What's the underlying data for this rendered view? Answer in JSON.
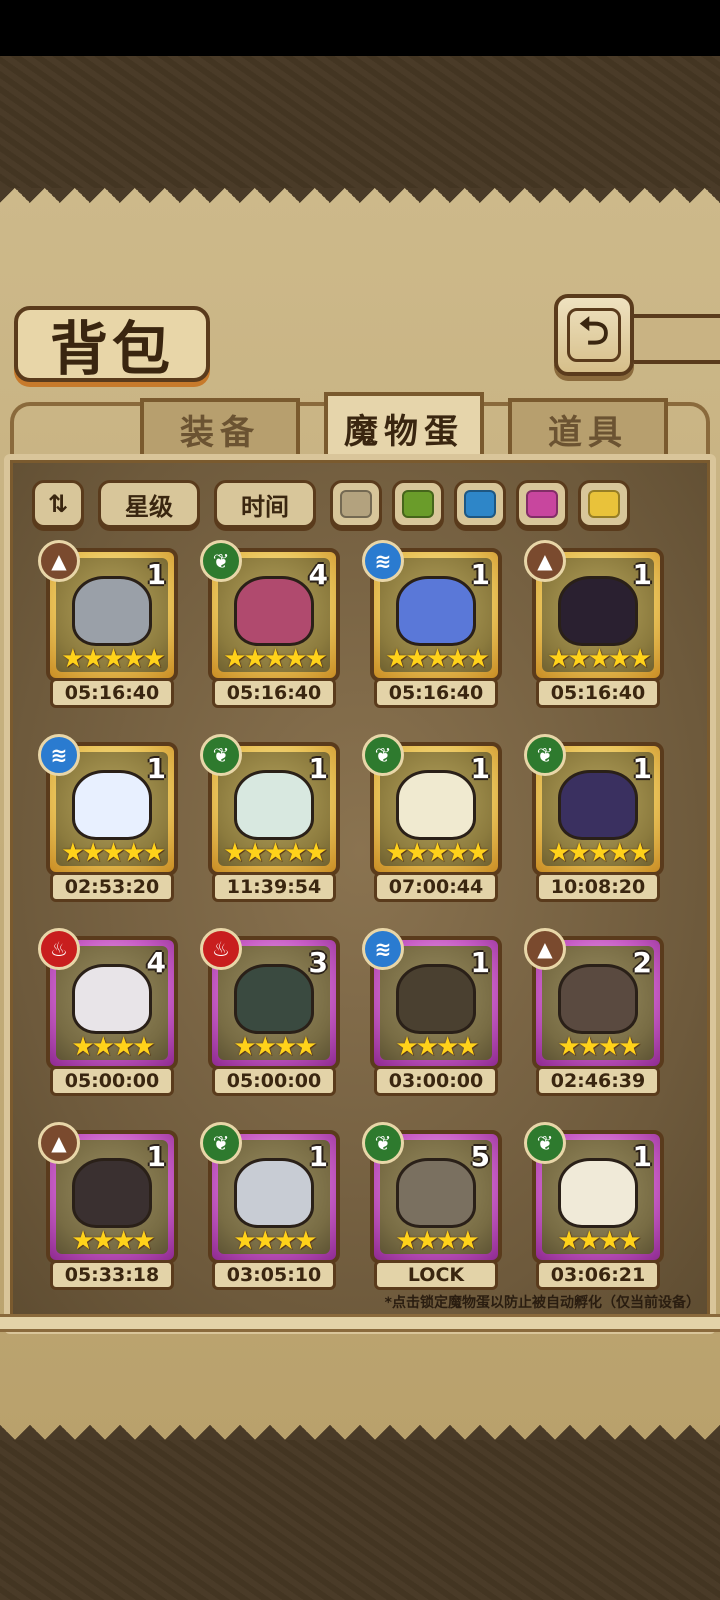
{
  "header": {
    "title": "背包"
  },
  "tabs": [
    {
      "label": "装备",
      "active": false
    },
    {
      "label": "魔物蛋",
      "active": true
    },
    {
      "label": "道具",
      "active": false
    }
  ],
  "filters": {
    "sort_icon": "sort-toggle-icon",
    "star_label": "星级",
    "time_label": "时间",
    "colors": [
      "#b3a27e",
      "#6a9c2a",
      "#2e86c8",
      "#c8469e",
      "#e9c23a"
    ]
  },
  "items": [
    {
      "element": "earth",
      "rarity": "gold",
      "count": "1",
      "stars": 5,
      "timer": "05:16:40",
      "icon": "cube-egg-icon"
    },
    {
      "element": "leaf",
      "rarity": "gold",
      "count": "4",
      "stars": 5,
      "timer": "05:16:40",
      "icon": "katana-egg-icon"
    },
    {
      "element": "water",
      "rarity": "gold",
      "count": "1",
      "stars": 5,
      "timer": "05:16:40",
      "icon": "ice-blade-egg-icon"
    },
    {
      "element": "earth",
      "rarity": "gold",
      "count": "1",
      "stars": 5,
      "timer": "05:16:40",
      "icon": "dark-hood-egg-icon"
    },
    {
      "element": "water",
      "rarity": "gold",
      "count": "1",
      "stars": 5,
      "timer": "02:53:20",
      "icon": "heart-egg-icon"
    },
    {
      "element": "leaf",
      "rarity": "gold",
      "count": "1",
      "stars": 5,
      "timer": "11:39:54",
      "icon": "flower-egg-icon"
    },
    {
      "element": "leaf",
      "rarity": "gold",
      "count": "1",
      "stars": 5,
      "timer": "07:00:44",
      "icon": "bulb-egg-icon"
    },
    {
      "element": "leaf",
      "rarity": "gold",
      "count": "1",
      "stars": 5,
      "timer": "10:08:20",
      "icon": "crystal-egg-icon"
    },
    {
      "element": "fire",
      "rarity": "purple",
      "count": "4",
      "stars": 4,
      "timer": "05:00:00",
      "icon": "white-box-egg-icon"
    },
    {
      "element": "fire",
      "rarity": "purple",
      "count": "3",
      "stars": 4,
      "timer": "05:00:00",
      "icon": "green-box-egg-icon"
    },
    {
      "element": "water",
      "rarity": "purple",
      "count": "1",
      "stars": 4,
      "timer": "03:00:00",
      "icon": "scarf-egg-icon"
    },
    {
      "element": "earth",
      "rarity": "purple",
      "count": "2",
      "stars": 4,
      "timer": "02:46:39",
      "icon": "gear-egg-icon"
    },
    {
      "element": "earth",
      "rarity": "purple",
      "count": "1",
      "stars": 4,
      "timer": "05:33:18",
      "icon": "bow-egg-icon"
    },
    {
      "element": "leaf",
      "rarity": "purple",
      "count": "1",
      "stars": 4,
      "timer": "03:05:10",
      "icon": "horn-egg-icon"
    },
    {
      "element": "leaf",
      "rarity": "purple",
      "count": "5",
      "stars": 4,
      "timer": "LOCK",
      "icon": "kunai-egg-icon"
    },
    {
      "element": "leaf",
      "rarity": "purple",
      "count": "1",
      "stars": 4,
      "timer": "03:06:21",
      "icon": "owl-egg-icon"
    }
  ],
  "footnote": "*点击锁定魔物蛋以防止被自动孵化（仅当前设备）"
}
